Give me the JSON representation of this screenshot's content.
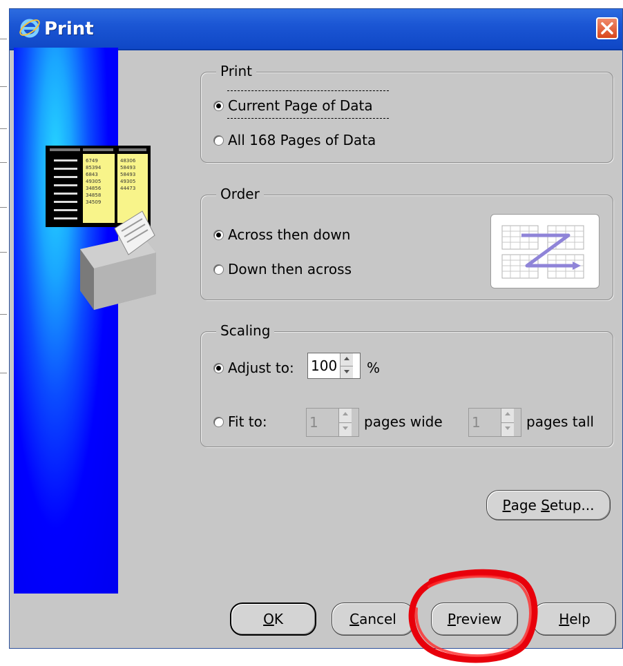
{
  "window": {
    "title": "Print"
  },
  "print_group": {
    "label": "Print",
    "options": [
      {
        "label": "Current Page of Data",
        "checked": true
      },
      {
        "label": "All 168 Pages of Data",
        "checked": false
      }
    ]
  },
  "order_group": {
    "label": "Order",
    "options": [
      {
        "label": "Across then down",
        "checked": true
      },
      {
        "label": "Down then across",
        "checked": false
      }
    ]
  },
  "scaling_group": {
    "label": "Scaling",
    "adjust_label": "Adjust to:",
    "adjust_value": "100",
    "percent_sign": "%",
    "fit_label": "Fit to:",
    "wide_value": "1",
    "wide_label": "pages wide",
    "tall_value": "1",
    "tall_label": "pages tall",
    "adjust_checked": true,
    "fit_checked": false
  },
  "buttons": {
    "page_setup": {
      "underlined": "P",
      "rest": "age ",
      "underlined2": "S",
      "rest2": "etup..."
    },
    "ok": {
      "underlined": "O",
      "rest": "K"
    },
    "cancel": {
      "underlined": "C",
      "rest": "ancel"
    },
    "preview": {
      "underlined": "P",
      "rest": "review"
    },
    "help": {
      "underlined": "H",
      "rest": "elp"
    }
  },
  "printer_graphic_numbers": {
    "col1": [
      "6749",
      "85394",
      "6843",
      "49305",
      "34856",
      "34858",
      "34509"
    ],
    "col2": [
      "48306",
      "58493",
      "58493",
      "49305",
      "44473"
    ]
  },
  "colors": {
    "titlebar": "#1b56d4",
    "side_panel": "#0000ff",
    "dialog_bg": "#c7c7c7",
    "annotation": "#e8000b"
  }
}
